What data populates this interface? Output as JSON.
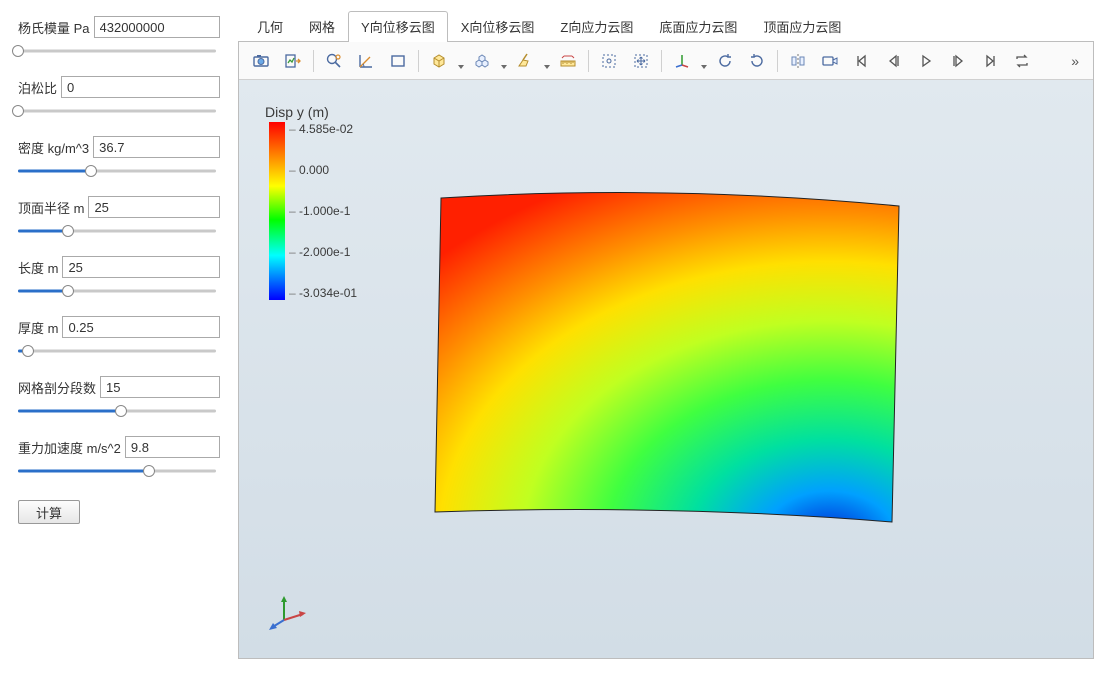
{
  "sidebar": {
    "params": [
      {
        "label": "杨氏模量 Pa",
        "value": "432000000",
        "slider_pct": 0
      },
      {
        "label": "泊松比",
        "value": "0",
        "slider_pct": 0
      },
      {
        "label": "密度 kg/m^3",
        "value": "36.7",
        "slider_pct": 37
      },
      {
        "label": "顶面半径 m",
        "value": "25",
        "slider_pct": 25
      },
      {
        "label": "长度 m",
        "value": "25",
        "slider_pct": 25
      },
      {
        "label": "厚度 m",
        "value": "0.25",
        "slider_pct": 5
      },
      {
        "label": "网格剖分段数",
        "value": "15",
        "slider_pct": 52
      },
      {
        "label": "重力加速度 m/s^2",
        "value": "9.8",
        "slider_pct": 66
      }
    ],
    "compute_label": "计算"
  },
  "tabs": [
    "几何",
    "网格",
    "Y向位移云图",
    "X向位移云图",
    "Z向应力云图",
    "底面应力云图",
    "顶面应力云图"
  ],
  "active_tab_index": 2,
  "toolbar": {
    "icons": [
      "camera-icon",
      "chart-export-icon",
      "zoom-icon",
      "angle-icon",
      "rect-icon",
      "cube-icon",
      "cubes-icon",
      "broom-icon",
      "ruler-icon",
      "rubber-select-icon",
      "move-icon",
      "axes-icon",
      "rotate-left-icon",
      "rotate-right-icon",
      "mirror-v-icon",
      "video-icon",
      "skip-first-icon",
      "step-back-icon",
      "play-icon",
      "step-fwd-icon",
      "skip-last-icon",
      "loop-icon"
    ],
    "more": "»"
  },
  "legend": {
    "title": "Disp y (m)",
    "ticks": [
      "4.585e-02",
      "0.000",
      "-1.000e-1",
      "-2.000e-1",
      "-3.034e-01"
    ]
  },
  "chart_data": {
    "type": "heatmap",
    "title": "Disp y (m)",
    "field": "Y displacement",
    "unit": "m",
    "value_range": [
      -0.3034,
      0.04585
    ],
    "colorbar_ticks": [
      0.04585,
      0.0,
      -0.1,
      -0.2,
      -0.3034
    ],
    "colorscale": "rainbow (red=high → blue=low)",
    "description": "Contour plot of Y-direction displacement on a deformed curved plate. Top region is near 0.04585 m (red/orange), grading through yellow/green to blue ≈ -0.3034 m at the bottom-right corner."
  }
}
